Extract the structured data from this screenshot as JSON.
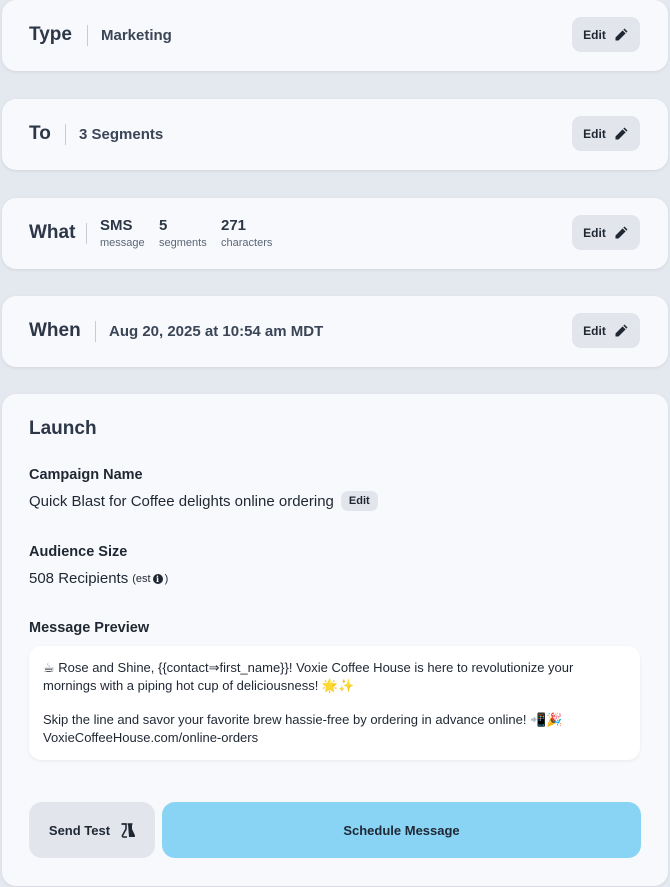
{
  "summary": {
    "type": {
      "label": "Type",
      "value": "Marketing",
      "edit_label": "Edit"
    },
    "to": {
      "label": "To",
      "value": "3 Segments",
      "edit_label": "Edit"
    },
    "what": {
      "label": "What",
      "edit_label": "Edit",
      "stats": [
        {
          "value": "SMS",
          "label": "message"
        },
        {
          "value": "5",
          "label": "segments"
        },
        {
          "value": "271",
          "label": "characters"
        }
      ]
    },
    "when": {
      "label": "When",
      "value": "Aug 20, 2025 at 10:54 am MDT",
      "edit_label": "Edit"
    }
  },
  "launch": {
    "title": "Launch",
    "campaign_name": {
      "heading": "Campaign Name",
      "value": "Quick Blast for Coffee delights online ordering",
      "edit_label": "Edit"
    },
    "audience": {
      "heading": "Audience Size",
      "value": "508 Recipients",
      "est_open": "(est",
      "est_close": ")"
    },
    "preview": {
      "heading": "Message Preview",
      "line1": "☕ Rose and Shine, {{contact⇒first_name}}! Voxie Coffee House is here to revolutionize your mornings with a piping hot cup of deliciousness! 🌟✨",
      "line2": "Skip the line and savor your favorite brew hassie-free by ordering in advance online! 📲🎉 VoxieCoffeeHouse.com/online-orders"
    },
    "send_test_label": "Send Test",
    "schedule_label": "Schedule Message"
  },
  "colors": {
    "background": "#e4e8ef",
    "card": "#f7f9fc",
    "button": "#e2e6ec",
    "primary": "#89d4f5"
  }
}
